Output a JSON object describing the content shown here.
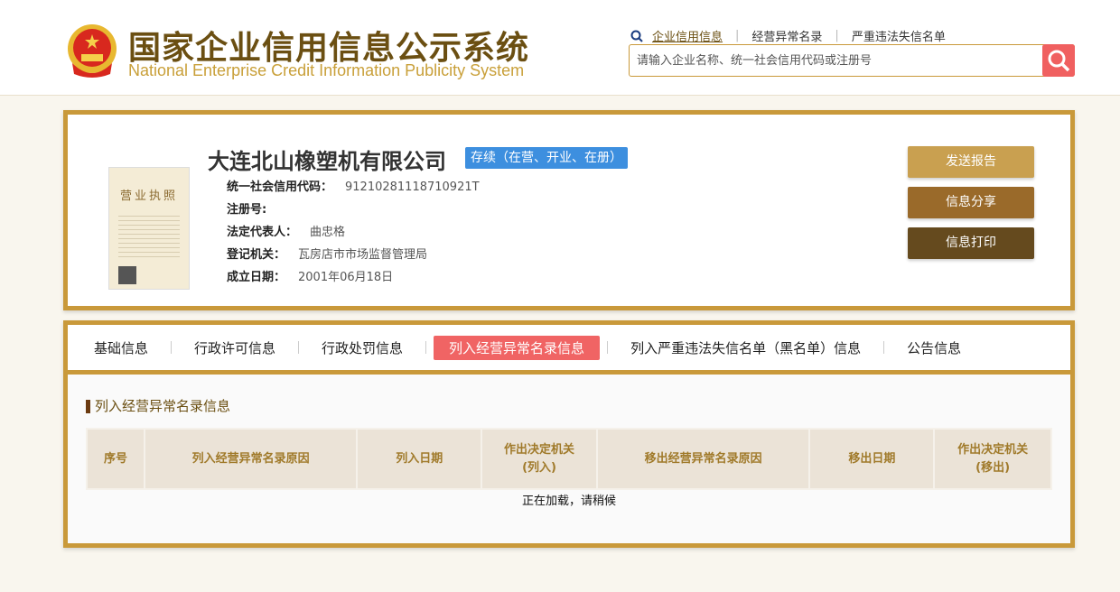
{
  "header": {
    "title_cn": "国家企业信用信息公示系统",
    "title_en": "National Enterprise Credit Information Publicity System",
    "links": [
      "企业信用信息",
      "经营异常名录",
      "严重违法失信名单"
    ],
    "search_placeholder": "请输入企业名称、统一社会信用代码或注册号"
  },
  "company": {
    "name": "大连北山橡塑机有限公司",
    "status": "存续（在营、开业、在册）",
    "fields": [
      {
        "label": "统一社会信用代码：",
        "value": "91210281118710921T"
      },
      {
        "label": "注册号:",
        "value": ""
      },
      {
        "label": "法定代表人：",
        "value": "曲忠格"
      },
      {
        "label": "登记机关：",
        "value": "瓦房店市市场监督管理局"
      },
      {
        "label": "成立日期：",
        "value": "2001年06月18日"
      }
    ],
    "license_text": "营业执照"
  },
  "actions": {
    "send": "发送报告",
    "share": "信息分享",
    "print": "信息打印"
  },
  "colors": {
    "gold": "#c9993a",
    "accent": "#f06464",
    "status": "#3d8fdf"
  },
  "tabs": [
    "基础信息",
    "行政许可信息",
    "行政处罚信息",
    "列入经营异常名录信息",
    "列入严重违法失信名单（黑名单）信息",
    "公告信息"
  ],
  "section": {
    "title": "列入经营异常名录信息",
    "columns": [
      "序号",
      "列入经营异常名录原因",
      "列入日期",
      "作出决定机关(列入)",
      "移出经营异常名录原因",
      "移出日期",
      "作出决定机关(移出)"
    ],
    "col_lines": [
      [
        "序号"
      ],
      [
        "列入经营异常名录原因"
      ],
      [
        "列入日期"
      ],
      [
        "作出决定机关",
        "(列入)"
      ],
      [
        "移出经营异常名录原因"
      ],
      [
        "移出日期"
      ],
      [
        "作出决定机关",
        "(移出)"
      ]
    ],
    "loading": "正在加载，请稍候"
  }
}
